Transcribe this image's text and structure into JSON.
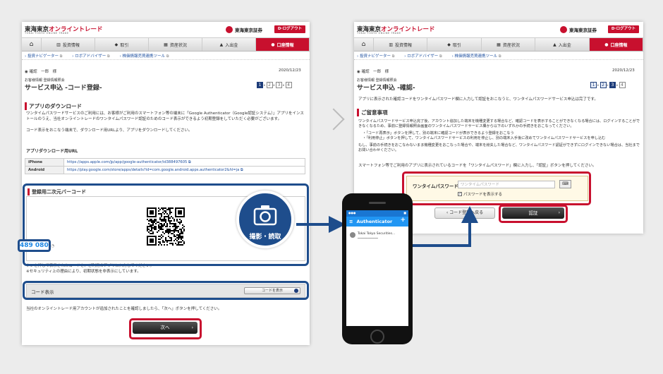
{
  "common": {
    "logo": "東海東京オンライントレード",
    "logo_red": "オンライントレード",
    "logo_black": "東海東京",
    "logo_sub": "TOKAI TOKYO ONLINE TRADE",
    "brand": "東海東京証券",
    "logout": "ログアウト",
    "nav": [
      "投資情報",
      "取引",
      "資産状況",
      "入出金",
      "口座情報"
    ],
    "home_icon": "⌂",
    "subnav": [
      "投資ナビゲーター",
      "ロボアドバイザー",
      "株価情報売買連携ツール"
    ],
    "user": "確認　一郎　様",
    "date": "2020/12/23",
    "category": "お客様情報 登録情報照会",
    "steps": [
      "1",
      "2",
      "3",
      "4"
    ]
  },
  "left": {
    "title": "サービス申込 -コード登録-",
    "section1": "アプリのダウンロード",
    "para1": "ワンタイムパスワードサービスのご利用には、お客様がご利用のスマートフォン等の端末に「Google Authenticator（Google認証システム）」アプリをインストールのうえ、当社オンライントレードのワンタイムパスワード認証のためのコード表示ができるよう初期登録をしていただく必要がございます。",
    "para2": "コード表示をおこなう端末で、ダウンロード用URLより、アプリをダウンロードしてください。",
    "dl_heading": "アプリダウンロード用URL",
    "dl_rows": [
      {
        "k": "iPhone",
        "v": "https://apps.apple.com/jp/app/google-authenticator/id388497605"
      },
      {
        "k": "Android",
        "v": "https://play.google.com/store/apps/details?id=com.google.android.apps.authenticator2&hl=ja"
      }
    ],
    "qr_heading": "登録用二次元バーコード",
    "para3": "タンを押して表示されたコードを、ご利用のアプリに入力してください。",
    "para4": "※セキュリティ上の理由により、初期状態を非表示にしています。",
    "code_label": "コード表示",
    "code_button": "コードを表示",
    "para5": "当社のオンライントレード用アカウントが追加されたことを確認しましたら、「次へ」ボタンを押してください。",
    "next": "次へ"
  },
  "camera": {
    "label": "撮影・読取"
  },
  "phone": {
    "app_title": "Authenticator",
    "account": "Tokai Tokyo Securities...",
    "code": "489 080"
  },
  "right": {
    "title": "サービス申込 -確認-",
    "intro": "アプリに表示された確認コードをワンタイムパスワード欄に入力して認証をおこなうと、ワンタイムパスワードサービス申込は完了です。",
    "section": "ご留意事項",
    "para1": "ワンタイムパスワードサービス申込完了後、アカウント追加した端末を機種変更する場合など、確認コードを表示することができなくなる場合には、ログインすることができなくなるため、事前に登録情報照会画面のワンタイムパスワードサービス欄から以下のいずれかの手続きをおこなってください。",
    "bullets": [
      "・「コード再表示」ボタンを押して、別の端末に確認コードが表示できるよう登録をおこなう",
      "・「利用停止」ボタンを押して、ワンタイムパスワードサービスの利用を停止し、別の端末入手後に改めてワンタイムパスワードサービスを申し込む"
    ],
    "para2": "もし、事前の手続きをおこなわないまま機種変更をおこなった場合や、端末を紛失した場合など、ワンタイムパスワード認証ができずにログインできない場合は、当社までお問い合わせください。",
    "para3": "スマートフォン等でご利用のアプリに表示されているコードを「ワンタイムパスワード」欄に入力し、「認証」ボタンを押してください。",
    "otp_label": "ワンタイムパスワード",
    "otp_placeholder": "ワンタイムパスワード",
    "show_password": "パスワードを表示する",
    "back_button": "コード登録へ戻る",
    "auth_button": "認証"
  }
}
